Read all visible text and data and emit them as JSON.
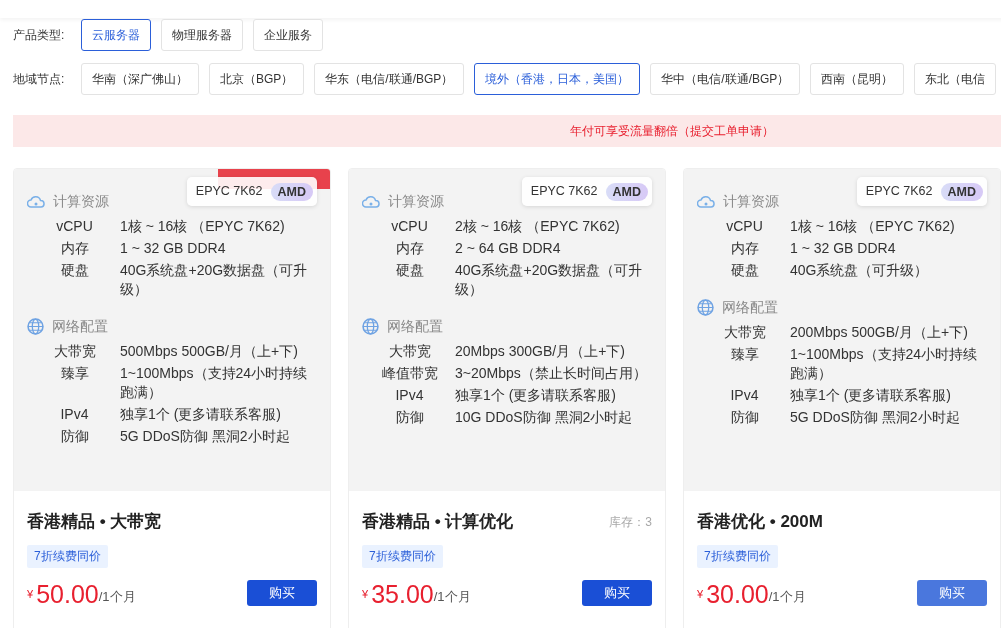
{
  "product_type": {
    "label": "产品类型:",
    "options": [
      {
        "label": "云服务器",
        "selected": true
      },
      {
        "label": "物理服务器",
        "selected": false
      },
      {
        "label": "企业服务",
        "selected": false
      }
    ]
  },
  "region": {
    "label": "地域节点:",
    "options": [
      {
        "label": "华南（深广佛山）",
        "selected": false
      },
      {
        "label": "北京（BGP）",
        "selected": false
      },
      {
        "label": "华东（电信/联通/BGP）",
        "selected": false
      },
      {
        "label": "境外（香港，日本，美国）",
        "selected": true
      },
      {
        "label": "华中（电信/联通/BGP）",
        "selected": false
      },
      {
        "label": "西南（昆明）",
        "selected": false
      },
      {
        "label": "东北（电信",
        "selected": false
      }
    ]
  },
  "notice": "年付可享受流量翻倍（提交工单申请）",
  "cards": [
    {
      "ribbon": true,
      "cpu_chip": "EPYC 7K62",
      "brand": "AMD",
      "compute_title": "计算资源",
      "compute": [
        {
          "label": "vCPU",
          "value": "1核 ~ 16核 （EPYC 7K62)"
        },
        {
          "label": "内存",
          "value": "1 ~ 32 GB DDR4"
        },
        {
          "label": "硬盘",
          "value": "40G系统盘+20G数据盘（可升级）"
        }
      ],
      "network_title": "网络配置",
      "network": [
        {
          "label": "大带宽",
          "value": "500Mbps 500GB/月（上+下)"
        },
        {
          "label": "臻享",
          "value": "1~100Mbps（支持24小时持续跑满）"
        },
        {
          "label": "IPv4",
          "value": "独享1个 (更多请联系客服)"
        },
        {
          "label": "防御",
          "value": "5G DDoS防御 黑洞2小时起"
        }
      ],
      "name": "香港精品 • 大带宽",
      "tag": "7折续费同价",
      "currency": "¥",
      "price": "50.00",
      "period": "/1个月",
      "buy": "购买",
      "hovered": false
    },
    {
      "ribbon": false,
      "cpu_chip": "EPYC 7K62",
      "brand": "AMD",
      "compute_title": "计算资源",
      "compute": [
        {
          "label": "vCPU",
          "value": "2核 ~ 16核 （EPYC 7K62)"
        },
        {
          "label": "内存",
          "value": "2 ~ 64 GB DDR4"
        },
        {
          "label": "硬盘",
          "value": "40G系统盘+20G数据盘（可升级）"
        }
      ],
      "network_title": "网络配置",
      "network": [
        {
          "label": "大带宽",
          "value": "20Mbps 300GB/月（上+下)"
        },
        {
          "label": "峰值带宽",
          "value": "3~20Mbps（禁止长时间占用）"
        },
        {
          "label": "IPv4",
          "value": "独享1个 (更多请联系客服)"
        },
        {
          "label": "防御",
          "value": "10G DDoS防御 黑洞2小时起"
        }
      ],
      "name": "香港精品 • 计算优化",
      "stock": "库存：3",
      "tag": "7折续费同价",
      "currency": "¥",
      "price": "35.00",
      "period": "/1个月",
      "buy": "购买",
      "hovered": false
    },
    {
      "ribbon": false,
      "cpu_chip": "EPYC 7K62",
      "brand": "AMD",
      "compute_title": "计算资源",
      "compute": [
        {
          "label": "vCPU",
          "value": "1核 ~ 16核 （EPYC 7K62)"
        },
        {
          "label": "内存",
          "value": "1 ~ 32 GB DDR4"
        },
        {
          "label": "硬盘",
          "value": "40G系统盘（可升级）"
        }
      ],
      "network_title": "网络配置",
      "network": [
        {
          "label": "大带宽",
          "value": "200Mbps 500GB/月（上+下)"
        },
        {
          "label": "臻享",
          "value": "1~100Mbps（支持24小时持续跑满）"
        },
        {
          "label": "IPv4",
          "value": "独享1个 (更多请联系客服)"
        },
        {
          "label": "防御",
          "value": "5G DDoS防御 黑洞2小时起"
        }
      ],
      "name": "香港优化 • 200M",
      "tag": "7折续费同价",
      "currency": "¥",
      "price": "30.00",
      "period": "/1个月",
      "buy": "购买",
      "hovered": true
    }
  ]
}
